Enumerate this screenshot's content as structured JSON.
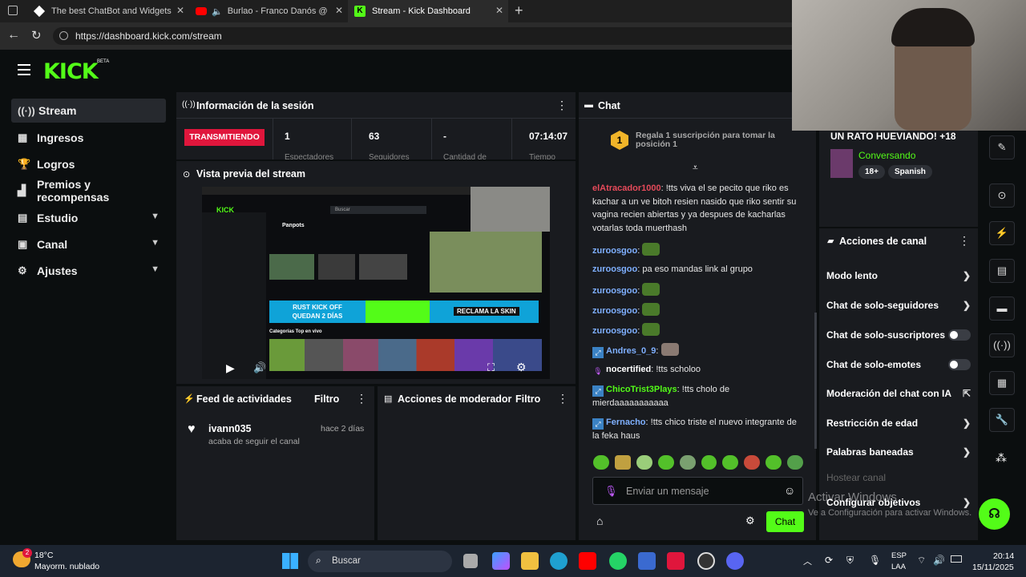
{
  "browser": {
    "tabs": [
      {
        "title": "The best ChatBot and Widgets fo"
      },
      {
        "title": "Burlao - Franco Danós @"
      },
      {
        "title": "Stream - Kick Dashboard"
      }
    ],
    "url": "https://dashboard.kick.com/stream"
  },
  "brand": {
    "logo": "KICK",
    "beta": "BETA",
    "accent": "#53fc18"
  },
  "sidebar": {
    "items": [
      {
        "label": "Stream",
        "icon": "broadcast-icon"
      },
      {
        "label": "Ingresos",
        "icon": "grid-icon"
      },
      {
        "label": "Logros",
        "icon": "trophy-icon"
      },
      {
        "label": "Premios y recompensas",
        "icon": "gift-icon"
      },
      {
        "label": "Estudio",
        "icon": "studio-icon"
      },
      {
        "label": "Canal",
        "icon": "channel-icon"
      },
      {
        "label": "Ajustes",
        "icon": "gear-icon"
      }
    ]
  },
  "session": {
    "title": "Información de la sesión",
    "status": "TRANSMITIENDO",
    "stats": [
      {
        "value": "1",
        "label": "Espectadores"
      },
      {
        "value": "63",
        "label": "Seguidores"
      },
      {
        "value": "-",
        "label": "Cantidad de"
      },
      {
        "value": "07:14:07",
        "label": "Tiempo"
      }
    ]
  },
  "preview": {
    "title": "Vista previa del stream",
    "banner1": "RUST KICK OFF",
    "banner2": "QUEDAN 2 DÍAS",
    "banner3": "RECLAMA LA SKIN",
    "search": "Buscar",
    "channel": "Panpots",
    "category": "Categorías Top en vivo"
  },
  "feed": {
    "title": "Feed de actividades",
    "filter": "Filtro",
    "items": [
      {
        "user": "ivann035",
        "time": "hace 2 días",
        "text": "acaba de seguir el canal"
      }
    ]
  },
  "moderator": {
    "title": "Acciones de moderador",
    "filter": "Filtro"
  },
  "chat": {
    "title": "Chat",
    "sub_rank": "1",
    "sub_text": "Regala 1 suscripción para tomar la posición 1",
    "messages": [
      {
        "user": "elAtracador1000",
        "color": "#e64a5a",
        "text": "!tts viva el se pecito que riko es kachar a un ve bitoh resien nasido que riko sentir su vagina recien abiertas y ya despues de kacharlas votarlas toda muerthash"
      },
      {
        "user": "zuroosgoo",
        "color": "#7fb0ff",
        "text": ""
      },
      {
        "user": "zuroosgoo",
        "color": "#7fb0ff",
        "text": "pa eso mandas link al grupo"
      },
      {
        "user": "zuroosgoo",
        "color": "#7fb0ff",
        "text": ""
      },
      {
        "user": "zuroosgoo",
        "color": "#7fb0ff",
        "text": ""
      },
      {
        "user": "zuroosgoo",
        "color": "#7fb0ff",
        "text": ""
      },
      {
        "user": "Andres_0_9",
        "color": "#7fb0ff",
        "text": ""
      },
      {
        "user": "nocertified",
        "color": "#ffffff",
        "text": "!tts scholoo"
      },
      {
        "user": "ChicoTrist3Plays",
        "color": "#53fc18",
        "text": "!tts cholo de mierdaaaaaaaaaaa"
      },
      {
        "user": "Fernacho",
        "color": "#7fb0ff",
        "text": "!tts chico triste el nuevo integrante de la feka haus"
      }
    ],
    "placeholder": "Enviar un mensaje",
    "send": "Chat"
  },
  "stream_info": {
    "title": "UN RATO HUEVIANDO! +18",
    "category": "Conversando",
    "tags": [
      "18+",
      "Spanish"
    ]
  },
  "channel_actions": {
    "title": "Acciones de canal",
    "items": [
      {
        "label": "Modo lento",
        "kind": "chevron"
      },
      {
        "label": "Chat de solo-seguidores",
        "kind": "chevron"
      },
      {
        "label": "Chat de solo-suscriptores",
        "kind": "toggle"
      },
      {
        "label": "Chat de solo-emotes",
        "kind": "toggle"
      },
      {
        "label": "Moderación del chat con IA",
        "kind": "external"
      },
      {
        "label": "Restricción de edad",
        "kind": "chevron"
      },
      {
        "label": "Palabras baneadas",
        "kind": "chevron"
      },
      {
        "label": "Hostear canal",
        "kind": "disabled"
      },
      {
        "label": "Configurar objetivos",
        "kind": "chevron"
      }
    ]
  },
  "watermark": {
    "line1": "Activar Windows",
    "line2": "Ve a Configuración para activar Windows."
  },
  "taskbar": {
    "weather_temp": "18°C",
    "weather_text": "Mayorm. nublado",
    "search": "Buscar",
    "lang1": "ESP",
    "lang2": "LAA",
    "time": "20:14",
    "date": "15/11/2025"
  }
}
